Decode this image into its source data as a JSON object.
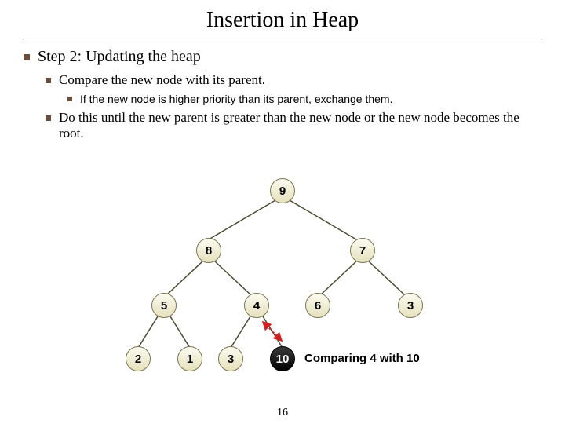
{
  "title": "Insertion in Heap",
  "bullets": {
    "step": "Step 2: Updating the heap",
    "compare": "Compare the new node with its parent.",
    "exchange": "If the new node is higher priority than its parent, exchange them.",
    "until": "Do this until the new parent is greater than the new node or the new node becomes the root."
  },
  "tree": {
    "n9": "9",
    "n8": "8",
    "n7": "7",
    "n5": "5",
    "n4": "4",
    "n6": "6",
    "n3r": "3",
    "n2": "2",
    "n1": "1",
    "n3l": "3",
    "n10": "10"
  },
  "caption": "Comparing 4 with 10",
  "page": "16",
  "chart_data": {
    "type": "table",
    "title": "Binary heap during insertion (sift-up)",
    "nodes": [
      {
        "id": "r",
        "value": 9,
        "parent": null
      },
      {
        "id": "l",
        "value": 8,
        "parent": "r"
      },
      {
        "id": "rr",
        "value": 7,
        "parent": "r"
      },
      {
        "id": "ll",
        "value": 5,
        "parent": "l"
      },
      {
        "id": "lr",
        "value": 4,
        "parent": "l"
      },
      {
        "id": "rrl",
        "value": 6,
        "parent": "rr"
      },
      {
        "id": "rrr",
        "value": 3,
        "parent": "rr"
      },
      {
        "id": "lll",
        "value": 2,
        "parent": "ll"
      },
      {
        "id": "llr",
        "value": 1,
        "parent": "ll"
      },
      {
        "id": "lrl",
        "value": 3,
        "parent": "lr"
      },
      {
        "id": "lrr",
        "value": 10,
        "parent": "lr",
        "highlight": true
      }
    ],
    "comparison": {
      "child": 10,
      "parent": 4
    }
  }
}
